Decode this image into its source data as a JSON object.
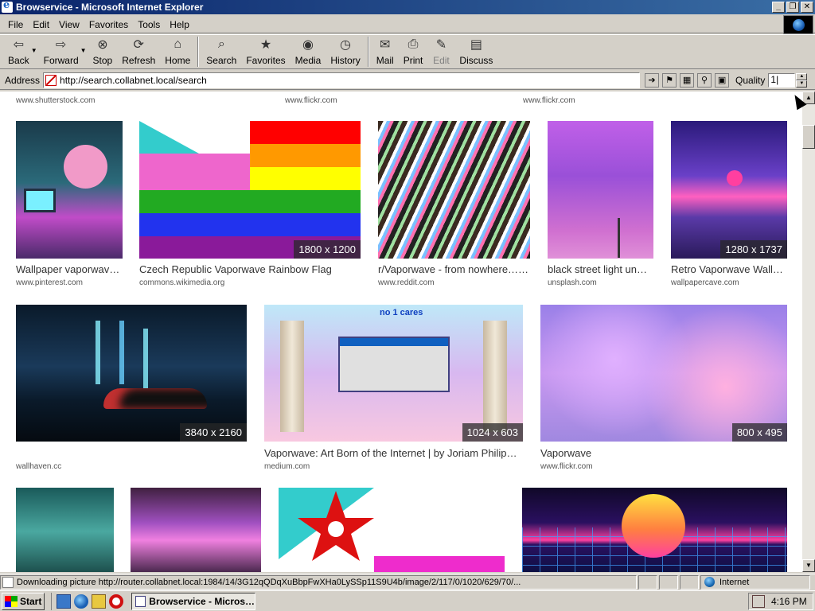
{
  "window": {
    "title": "Browservice - Microsoft Internet Explorer",
    "buttons": [
      "_",
      "❐",
      "✕"
    ]
  },
  "menu": [
    "File",
    "Edit",
    "View",
    "Favorites",
    "Tools",
    "Help"
  ],
  "toolbar": {
    "back": "Back",
    "forward": "Forward",
    "stop": "Stop",
    "refresh": "Refresh",
    "home": "Home",
    "search": "Search",
    "favorites": "Favorites",
    "media": "Media",
    "history": "History",
    "mail": "Mail",
    "print": "Print",
    "edit": "Edit",
    "discuss": "Discuss"
  },
  "address": {
    "label": "Address",
    "url": "http://search.collabnet.local/search",
    "quality_label": "Quality",
    "quality_value": "1|"
  },
  "results": {
    "top_sources": [
      "www.shutterstock.com",
      "www.flickr.com",
      "www.flickr.com"
    ],
    "row1": [
      {
        "title": "Wallpaper vaporwav…",
        "source": "www.pinterest.com",
        "dim": ""
      },
      {
        "title": "Czech Republic Vaporwave Rainbow Flag",
        "source": "commons.wikimedia.org",
        "dim": "1800 x 1200"
      },
      {
        "title": "r/Vaporwave - from nowhere…,…",
        "source": "www.reddit.com",
        "dim": ""
      },
      {
        "title": "black street light un…",
        "source": "unsplash.com",
        "dim": ""
      },
      {
        "title": "Retro Vaporwave Wall…",
        "source": "wallpapercave.com",
        "dim": "1280 x 1737"
      }
    ],
    "row2": [
      {
        "title": "",
        "source": "wallhaven.cc",
        "dim": "3840 x 2160"
      },
      {
        "title": "Vaporwave: Art Born of the Internet | by Joriam Philip…",
        "source": "medium.com",
        "dim": "1024 x 603"
      },
      {
        "title": "Vaporwave",
        "source": "www.flickr.com",
        "dim": "800 x 495"
      }
    ],
    "meme_text": "no 1 cares"
  },
  "status": {
    "text": "Downloading picture http://router.collabnet.local:1984/14/3G12qQDqXuBbpFwXHa0LySSp11S9U4b/image/2/117/0/1020/629/70/...",
    "zone": "Internet"
  },
  "taskbar": {
    "start": "Start",
    "task": "Browservice - Micros…",
    "clock": "4:16 PM"
  },
  "colors": {
    "titlebar": "#0a246a",
    "chrome": "#d4d0c8"
  }
}
